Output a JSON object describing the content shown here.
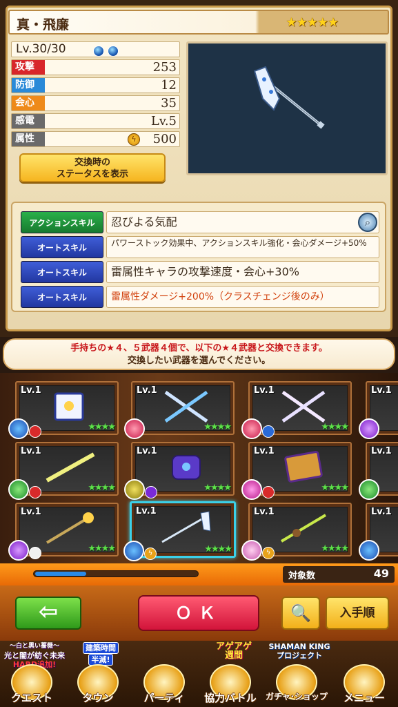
{
  "weapon": {
    "name": "真・飛廉",
    "rarity_stars": "★★★★★",
    "level": "Lv.30/30",
    "stats": [
      {
        "label": "攻撃",
        "value": "253",
        "color": "#d8262a"
      },
      {
        "label": "防御",
        "value": "12",
        "color": "#2a8ad8"
      },
      {
        "label": "会心",
        "value": "35",
        "color": "#ee8a1a"
      },
      {
        "label": "感電",
        "value": "Lv.5",
        "color": "#6a6a6a"
      },
      {
        "label": "属性",
        "value": "500",
        "color": "#6a6a6a"
      }
    ],
    "swap_button": [
      "交換時の",
      "ステータスを表示"
    ]
  },
  "skills": [
    {
      "type": "アクションスキル",
      "text": "忍びよる気配"
    },
    {
      "type": "オートスキル",
      "text": "パワーストック効果中、アクションスキル強化・会心ダメージ+50%"
    },
    {
      "type": "オートスキル",
      "text": "雷属性キャラの攻撃速度・会心+30%"
    },
    {
      "type": "オートスキル",
      "text": "雷属性ダメージ+200%（クラスチェンジ後のみ）"
    }
  ],
  "instruction": {
    "line1_a": "手持ちの★４、５武器４個で、以下の★４武器と交換できます。",
    "line2": "交換したい武器を選んでください。"
  },
  "grid": {
    "level_label": "Lv.1",
    "card_stars": "★★★★"
  },
  "count": {
    "label": "対象数",
    "value": "49"
  },
  "actions": {
    "back": "⇦",
    "ok": "ＯＫ",
    "search": "🔍",
    "sort": "入手順"
  },
  "nav": [
    {
      "label": "クエスト"
    },
    {
      "label": "タウン"
    },
    {
      "label": "パーティ"
    },
    {
      "label": "協力バトル"
    },
    {
      "label": "ガチャ･ショップ"
    },
    {
      "label": "メニュー"
    }
  ],
  "banners": {
    "quest_top": "〜白と黒い薔薇〜",
    "quest_mid": "光と闇が紡ぐ未来",
    "quest_bottom": "HARD追加!",
    "town_top": "建築時間",
    "town_bottom": "半減!",
    "coop_top": "アゲアゲ",
    "coop_bottom": "週間",
    "gacha_top": "SHAMAN KING",
    "gacha_bottom": "プロジェクト"
  },
  "colors": {
    "accent_orange": "#e86a06",
    "ok_red": "#d2143a",
    "back_green": "#2f9a1a",
    "selected_cyan": "#3bd0e8",
    "skill_green": "#177a2e",
    "skill_blue": "#2237a0"
  }
}
